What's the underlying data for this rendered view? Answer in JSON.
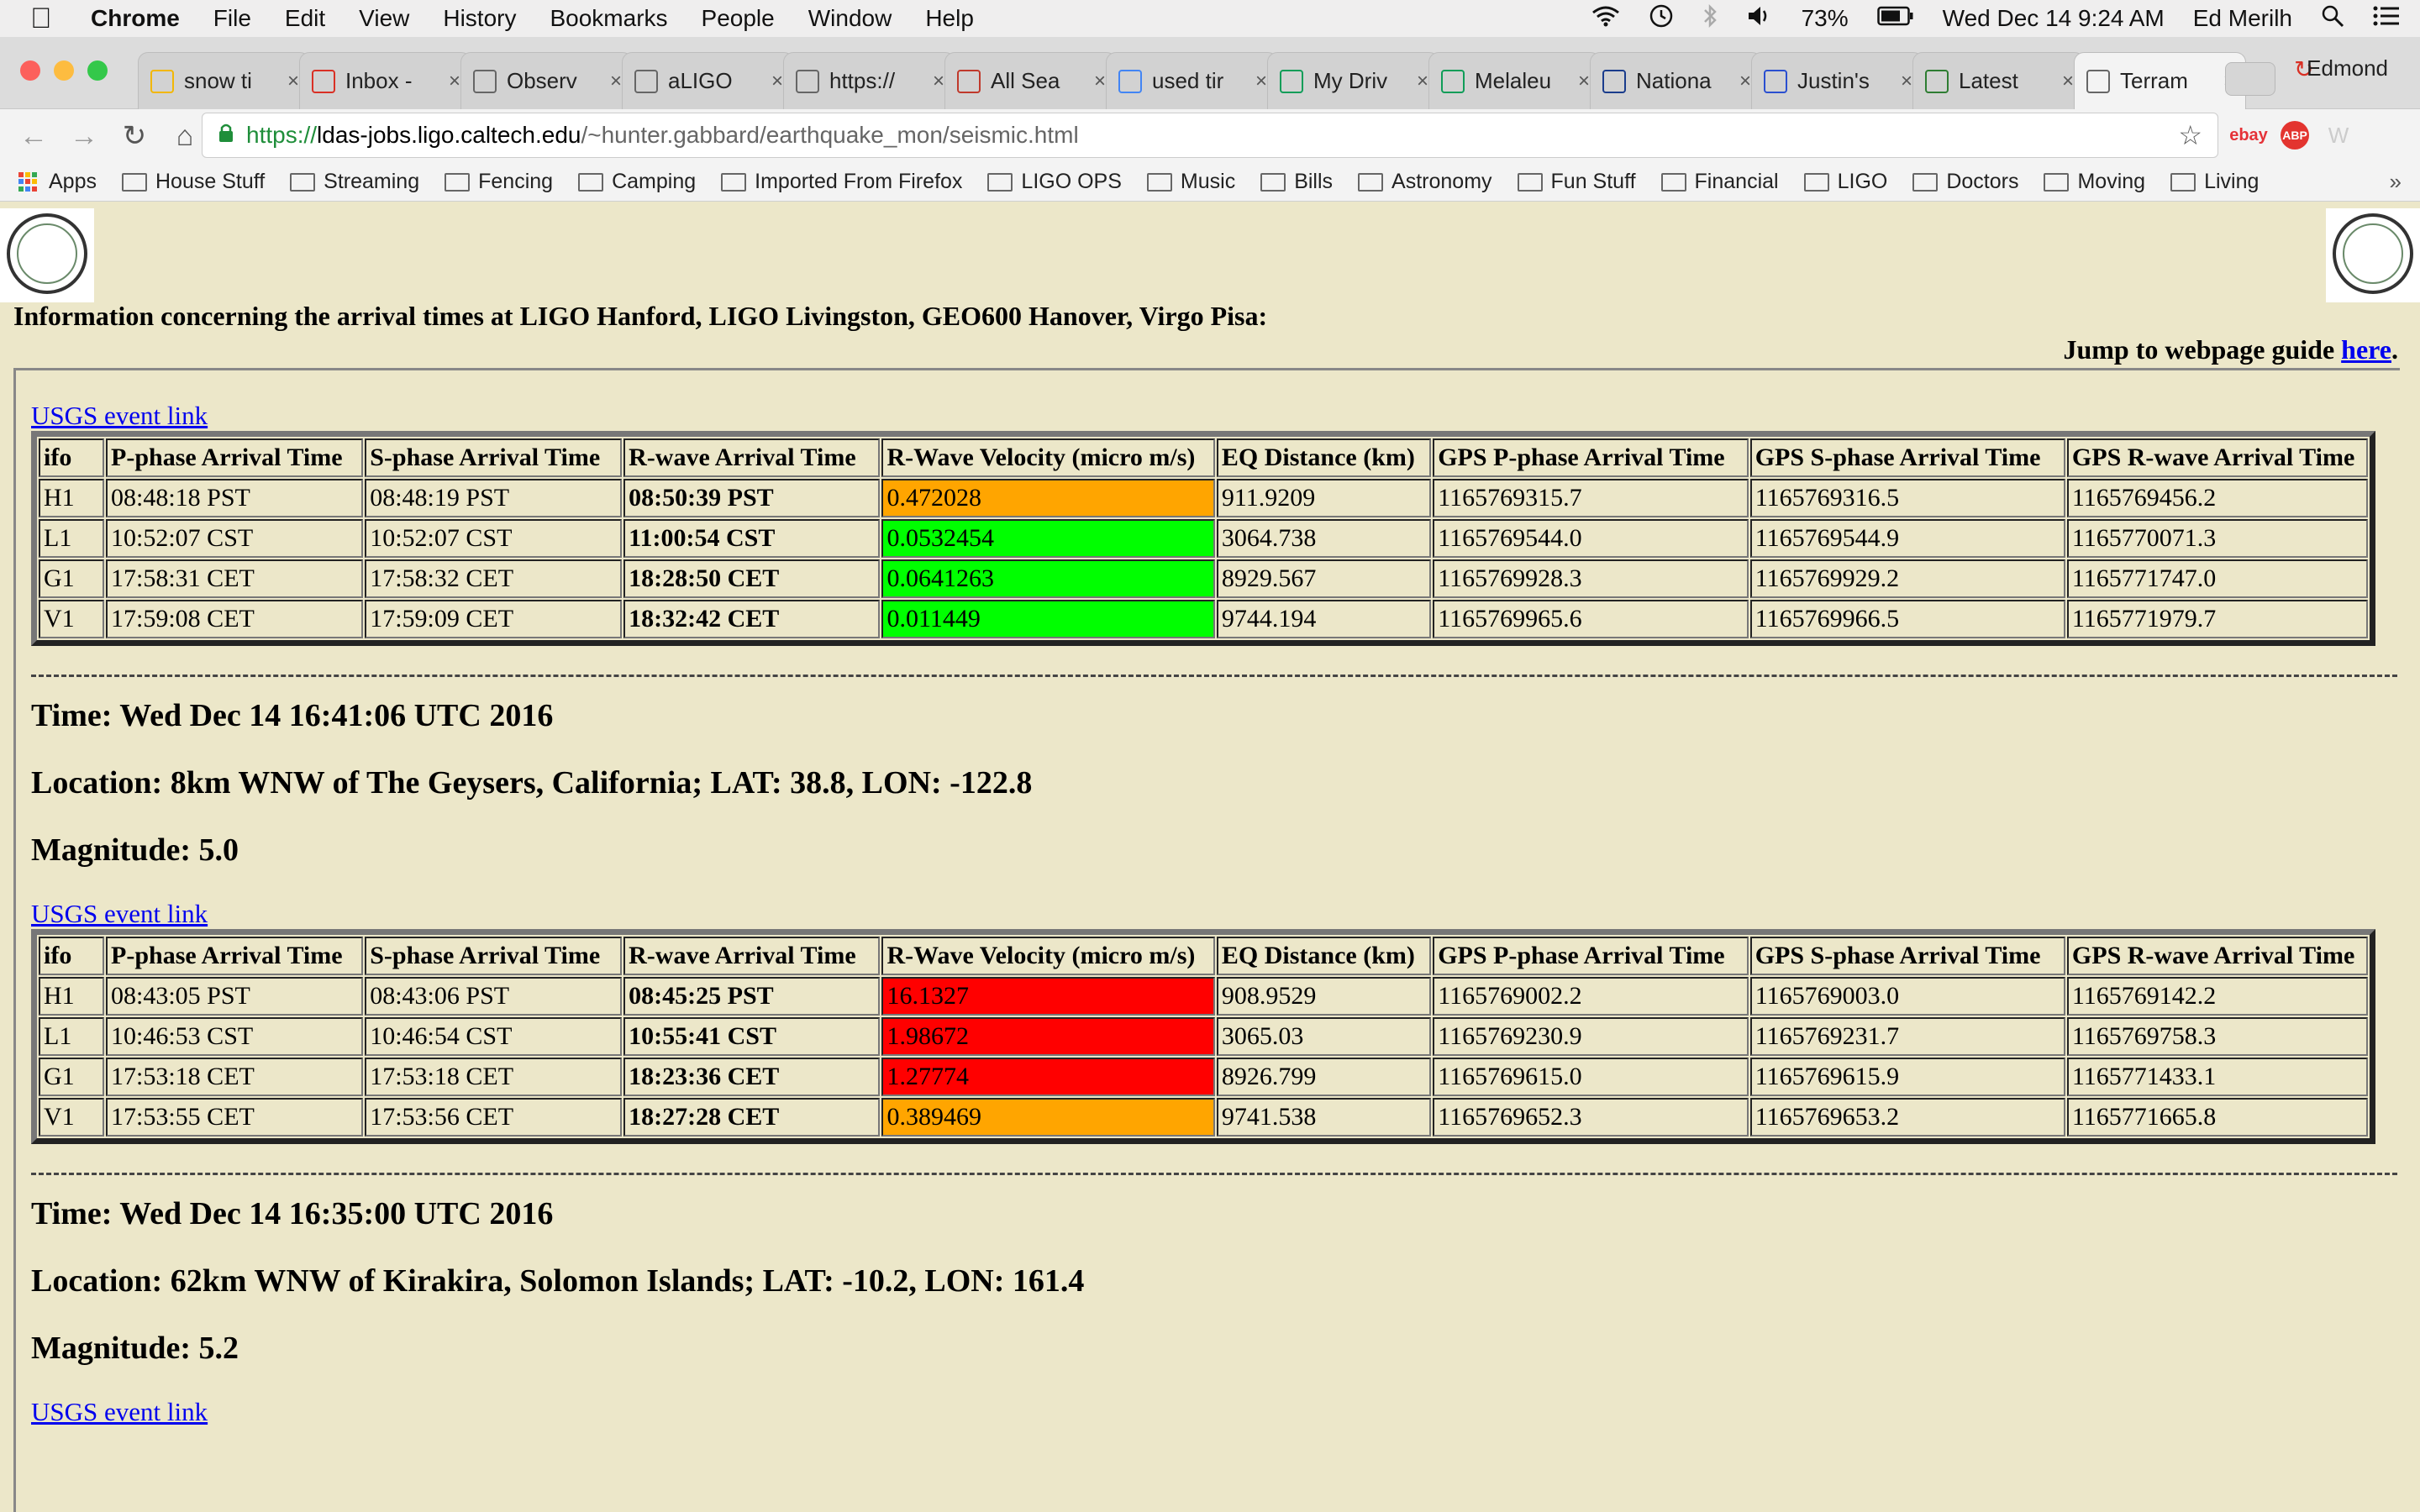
{
  "menubar": {
    "app": "Chrome",
    "items": [
      "File",
      "Edit",
      "View",
      "History",
      "Bookmarks",
      "People",
      "Window",
      "Help"
    ],
    "battery": "73%",
    "datetime": "Wed Dec 14  9:24 AM",
    "user": "Ed Merilh"
  },
  "tabs": [
    {
      "label": "snow ti",
      "icon": "sun-icon",
      "color": "#f2b705"
    },
    {
      "label": "Inbox -",
      "icon": "gmail-icon",
      "color": "#d93025"
    },
    {
      "label": "Observ",
      "icon": "page-icon",
      "color": "#666666"
    },
    {
      "label": "aLIGO",
      "icon": "page-icon",
      "color": "#666666"
    },
    {
      "label": "https://",
      "icon": "page-icon",
      "color": "#666666"
    },
    {
      "label": "All Sea",
      "icon": "jira-icon",
      "color": "#c0392b"
    },
    {
      "label": "used tir",
      "icon": "google-icon",
      "color": "#4285f4"
    },
    {
      "label": "My Driv",
      "icon": "drive-icon",
      "color": "#0f9d58"
    },
    {
      "label": "Melaleu",
      "icon": "sheets-icon",
      "color": "#0f9d58"
    },
    {
      "label": "Nationa",
      "icon": "weather-icon",
      "color": "#1a3c8c"
    },
    {
      "label": "Justin's",
      "icon": "blog-icon",
      "color": "#2a4fd0"
    },
    {
      "label": "Latest",
      "icon": "chart-icon",
      "color": "#2e7d32"
    },
    {
      "label": "Terram",
      "icon": "page-icon",
      "color": "#666666",
      "active": true
    }
  ],
  "profile": "Edmond",
  "address": {
    "scheme": "https://",
    "host": "ldas-jobs.ligo.caltech.edu",
    "path": "/~hunter.gabbard/earthquake_mon/seismic.html"
  },
  "extensions": [
    "ebay",
    "ABP",
    "W"
  ],
  "bookmarks": [
    "Apps",
    "House Stuff",
    "Streaming",
    "Fencing",
    "Camping",
    "Imported From Firefox",
    "LIGO OPS",
    "Music",
    "Bills",
    "Astronomy",
    "Fun Stuff",
    "Financial",
    "LIGO",
    "Doctors",
    "Moving",
    "Living"
  ],
  "page": {
    "intro": "Information concerning the arrival times at LIGO Hanford, LIGO Livingston, GEO600 Hanover, Virgo Pisa:",
    "jump_text": "Jump to webpage guide ",
    "jump_link": "here",
    "jump_end": ".",
    "link_label": "USGS event link",
    "columns": [
      "ifo",
      "P-phase Arrival Time",
      "S-phase Arrival Time",
      "R-wave Arrival Time",
      "R-Wave Velocity (micro m/s)",
      "EQ Distance (km)",
      "GPS P-phase Arrival Time",
      "GPS S-phase Arrival Time",
      "GPS R-wave Arrival Time"
    ],
    "colors": {
      "orange": "#ffa500",
      "green": "#00ff00",
      "red": "#ff0000"
    },
    "events": [
      {
        "rows": [
          {
            "ifo": "H1",
            "p": "08:48:18 PST",
            "s": "08:48:19 PST",
            "r": "08:50:39 PST",
            "vel": "0.472028",
            "level": "orange",
            "dist": "911.9209",
            "gp": "1165769315.7",
            "gs": "1165769316.5",
            "gr": "1165769456.2"
          },
          {
            "ifo": "L1",
            "p": "10:52:07 CST",
            "s": "10:52:07 CST",
            "r": "11:00:54 CST",
            "vel": "0.0532454",
            "level": "green",
            "dist": "3064.738",
            "gp": "1165769544.0",
            "gs": "1165769544.9",
            "gr": "1165770071.3"
          },
          {
            "ifo": "G1",
            "p": "17:58:31 CET",
            "s": "17:58:32 CET",
            "r": "18:28:50 CET",
            "vel": "0.0641263",
            "level": "green",
            "dist": "8929.567",
            "gp": "1165769928.3",
            "gs": "1165769929.2",
            "gr": "1165771747.0"
          },
          {
            "ifo": "V1",
            "p": "17:59:08 CET",
            "s": "17:59:09 CET",
            "r": "18:32:42 CET",
            "vel": "0.011449",
            "level": "green",
            "dist": "9744.194",
            "gp": "1165769965.6",
            "gs": "1165769966.5",
            "gr": "1165771979.7"
          }
        ]
      },
      {
        "time": "Time: Wed Dec 14 16:41:06 UTC 2016",
        "location": "Location: 8km WNW of The Geysers, California; LAT: 38.8, LON: -122.8",
        "magnitude": "Magnitude: 5.0",
        "rows": [
          {
            "ifo": "H1",
            "p": "08:43:05 PST",
            "s": "08:43:06 PST",
            "r": "08:45:25 PST",
            "vel": "16.1327",
            "level": "red",
            "dist": "908.9529",
            "gp": "1165769002.2",
            "gs": "1165769003.0",
            "gr": "1165769142.2"
          },
          {
            "ifo": "L1",
            "p": "10:46:53 CST",
            "s": "10:46:54 CST",
            "r": "10:55:41 CST",
            "vel": "1.98672",
            "level": "red",
            "dist": "3065.03",
            "gp": "1165769230.9",
            "gs": "1165769231.7",
            "gr": "1165769758.3"
          },
          {
            "ifo": "G1",
            "p": "17:53:18 CET",
            "s": "17:53:18 CET",
            "r": "18:23:36 CET",
            "vel": "1.27774",
            "level": "red",
            "dist": "8926.799",
            "gp": "1165769615.0",
            "gs": "1165769615.9",
            "gr": "1165771433.1"
          },
          {
            "ifo": "V1",
            "p": "17:53:55 CET",
            "s": "17:53:56 CET",
            "r": "18:27:28 CET",
            "vel": "0.389469",
            "level": "orange",
            "dist": "9741.538",
            "gp": "1165769652.3",
            "gs": "1165769653.2",
            "gr": "1165771665.8"
          }
        ]
      },
      {
        "time": "Time: Wed Dec 14 16:35:00 UTC 2016",
        "location": "Location: 62km WNW of Kirakira, Solomon Islands; LAT: -10.2, LON: 161.4",
        "magnitude": "Magnitude: 5.2"
      }
    ]
  }
}
